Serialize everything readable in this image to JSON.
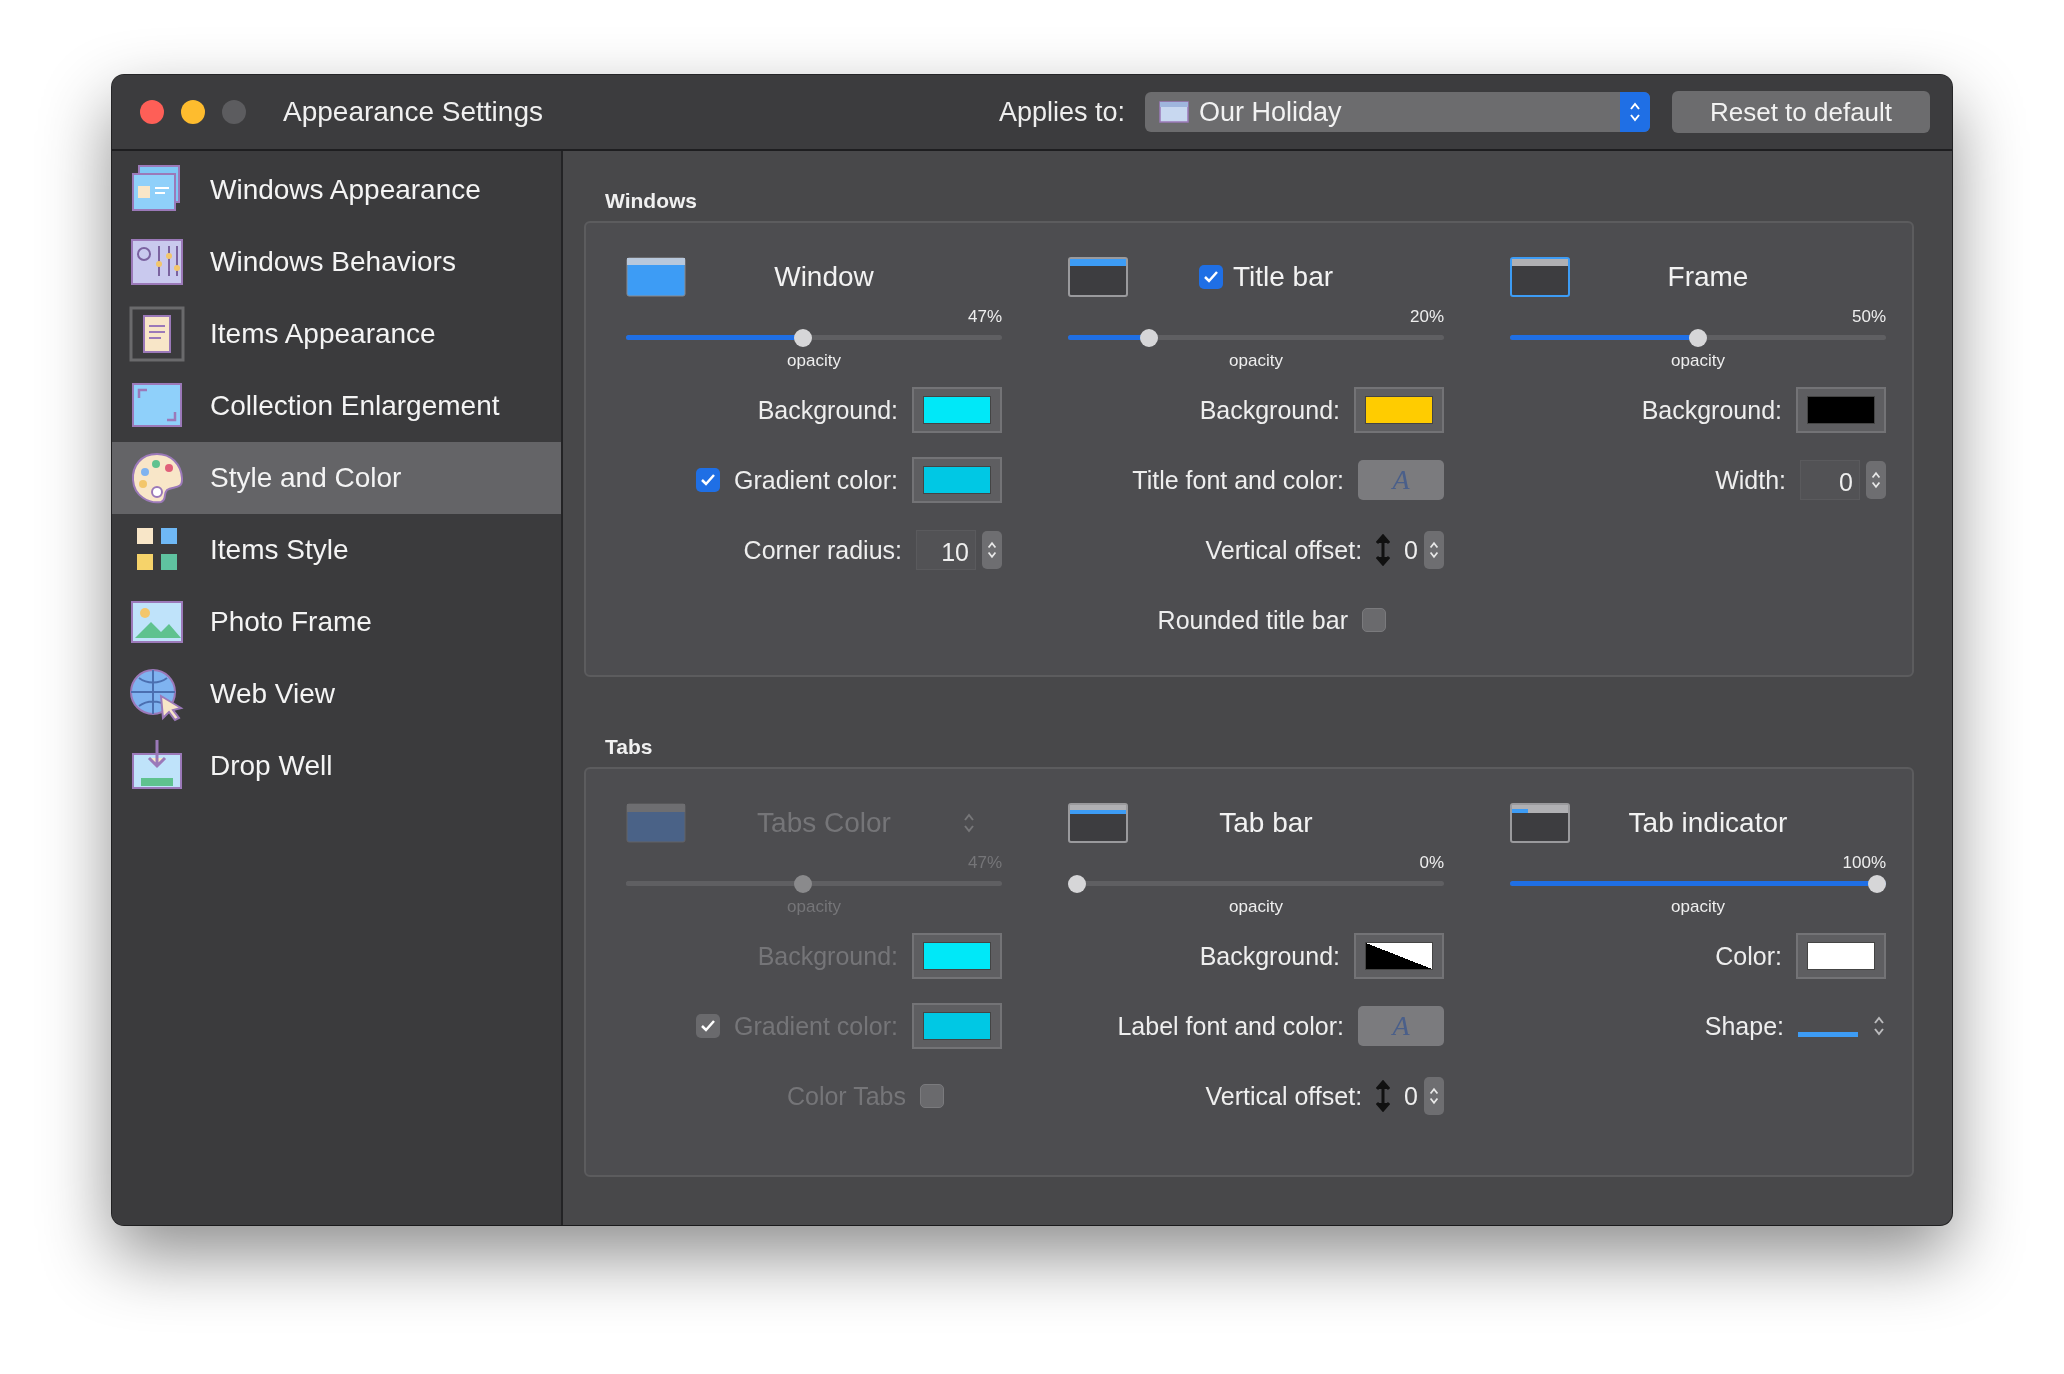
{
  "window": {
    "title": "Appearance Settings",
    "applies_label": "Applies to:",
    "applies_value": "Our Holiday",
    "reset_button": "Reset to default"
  },
  "sidebar": {
    "items": [
      {
        "label": "Windows Appearance",
        "selected": false
      },
      {
        "label": "Windows Behaviors",
        "selected": false
      },
      {
        "label": "Items Appearance",
        "selected": false
      },
      {
        "label": "Collection Enlargement",
        "selected": false
      },
      {
        "label": "Style and Color",
        "selected": true
      },
      {
        "label": "Items Style",
        "selected": false
      },
      {
        "label": "Photo Frame",
        "selected": false
      },
      {
        "label": "Web View",
        "selected": false
      },
      {
        "label": "Drop Well",
        "selected": false
      }
    ]
  },
  "sections": [
    {
      "title": "Windows",
      "columns": [
        {
          "title": "Window",
          "disabled": false,
          "slider": {
            "level": 0.47,
            "reading": "47%",
            "caption": "opacity"
          },
          "rows": [
            {
              "kind": "color",
              "label": "Background:",
              "color": "#00e8f8"
            },
            {
              "kind": "color",
              "label": "Gradient color:",
              "color": "#00c8e4",
              "checked": true
            },
            {
              "kind": "stepper",
              "label": "Corner radius:",
              "value": "10"
            }
          ]
        },
        {
          "title": "Title bar",
          "checked": true,
          "disabled": false,
          "slider": {
            "level": 0.2,
            "reading": "20%",
            "caption": "opacity"
          },
          "rows": [
            {
              "kind": "color",
              "label": "Background:",
              "color": "#ffcc00"
            },
            {
              "kind": "font",
              "label": "Title font and color:",
              "button_text": "A"
            },
            {
              "kind": "offset",
              "label": "Vertical offset:",
              "value": "0"
            },
            {
              "kind": "check",
              "label": "Rounded title bar",
              "checked": false
            }
          ]
        },
        {
          "title": "Frame",
          "disabled": false,
          "slider": {
            "level": 0.5,
            "reading": "50%",
            "caption": "opacity"
          },
          "rows": [
            {
              "kind": "color",
              "label": "Background:",
              "color": "#000000"
            },
            {
              "kind": "stepper",
              "label": "Width:",
              "value": "0"
            }
          ]
        }
      ]
    },
    {
      "title": "Tabs",
      "columns": [
        {
          "title": "Tabs Color",
          "disabled": true,
          "popup": true,
          "slider": {
            "level": 0.47,
            "reading": "47%",
            "caption": "opacity"
          },
          "rows": [
            {
              "kind": "color",
              "label": "Background:",
              "color": "#00e8f8"
            },
            {
              "kind": "color",
              "label": "Gradient color:",
              "color": "#00c8e4",
              "checked": true
            },
            {
              "kind": "check",
              "label": "Color Tabs",
              "checked": false
            }
          ]
        },
        {
          "title": "Tab bar",
          "disabled": false,
          "slider": {
            "level": 0,
            "reading": "0%",
            "caption": "opacity"
          },
          "rows": [
            {
              "kind": "split-color",
              "label": "Background:"
            },
            {
              "kind": "font",
              "label": "Label font and color:",
              "button_text": "A"
            },
            {
              "kind": "offset",
              "label": "Vertical offset:",
              "value": "0"
            }
          ]
        },
        {
          "title": "Tab indicator",
          "disabled": false,
          "slider": {
            "level": 1,
            "reading": "100%",
            "caption": "opacity"
          },
          "rows": [
            {
              "kind": "color",
              "label": "Color:",
              "color": "#ffffff"
            },
            {
              "kind": "shape",
              "label": "Shape:"
            }
          ]
        }
      ]
    }
  ]
}
